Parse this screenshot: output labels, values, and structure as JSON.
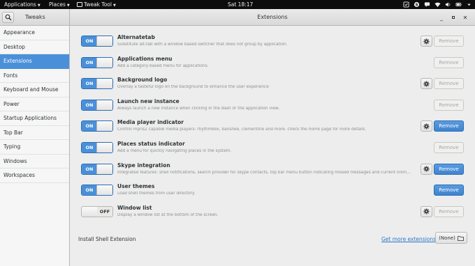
{
  "topbar": {
    "applications": "Applications",
    "places": "Places",
    "active_app": "Tweak Tool",
    "clock": "Sat 18:17"
  },
  "header": {
    "app_title": "Tweaks",
    "window_title": "Extensions"
  },
  "sidebar": {
    "items": [
      {
        "label": "Appearance"
      },
      {
        "label": "Desktop"
      },
      {
        "label": "Extensions"
      },
      {
        "label": "Fonts"
      },
      {
        "label": "Keyboard and Mouse"
      },
      {
        "label": "Power"
      },
      {
        "label": "Startup Applications"
      },
      {
        "label": "Top Bar"
      },
      {
        "label": "Typing"
      },
      {
        "label": "Windows"
      },
      {
        "label": "Workspaces"
      }
    ],
    "active": "Extensions"
  },
  "switch_labels": {
    "on": "ON",
    "off": "OFF"
  },
  "remove_label": "Remove",
  "extensions": [
    {
      "name": "Alternatetab",
      "desc": "Substitute alt-tab with a window based switcher that does not group by application.",
      "enabled": true,
      "has_settings": true,
      "remove_enabled": false
    },
    {
      "name": "Applications menu",
      "desc": "Add a category-based menu for applications.",
      "enabled": true,
      "has_settings": false,
      "remove_enabled": false
    },
    {
      "name": "Background logo",
      "desc": "Overlay a tasteful logo on the background to enhance the user experience",
      "enabled": true,
      "has_settings": true,
      "remove_enabled": false
    },
    {
      "name": "Launch new instance",
      "desc": "Always launch a new instance when clicking in the dash or the application view.",
      "enabled": true,
      "has_settings": false,
      "remove_enabled": false
    },
    {
      "name": "Media player indicator",
      "desc": "Control mpris2 capable media players: rhythmbox, banshee, clementine and more. check the home page for more details.",
      "enabled": true,
      "has_settings": true,
      "remove_enabled": true
    },
    {
      "name": "Places status indicator",
      "desc": "Add a menu for quickly navigating places in the system.",
      "enabled": true,
      "has_settings": false,
      "remove_enabled": false
    },
    {
      "name": "Skype integration",
      "desc": "Integrated features: shell notifications, search provider for skype contacts, top bar menu button indicating missed messages and current online presence. (ma...",
      "enabled": true,
      "has_settings": true,
      "remove_enabled": true
    },
    {
      "name": "User themes",
      "desc": "Load shell themes from user directory.",
      "enabled": true,
      "has_settings": false,
      "remove_enabled": true
    },
    {
      "name": "Window list",
      "desc": "Display a window list at the bottom of the screen.",
      "enabled": false,
      "has_settings": true,
      "remove_enabled": false
    }
  ],
  "install": {
    "label": "Install Shell Extension",
    "link": "Get more extensions",
    "button": "(None)"
  },
  "colors": {
    "accent": "#4a90d9",
    "link": "#2a76c6"
  }
}
